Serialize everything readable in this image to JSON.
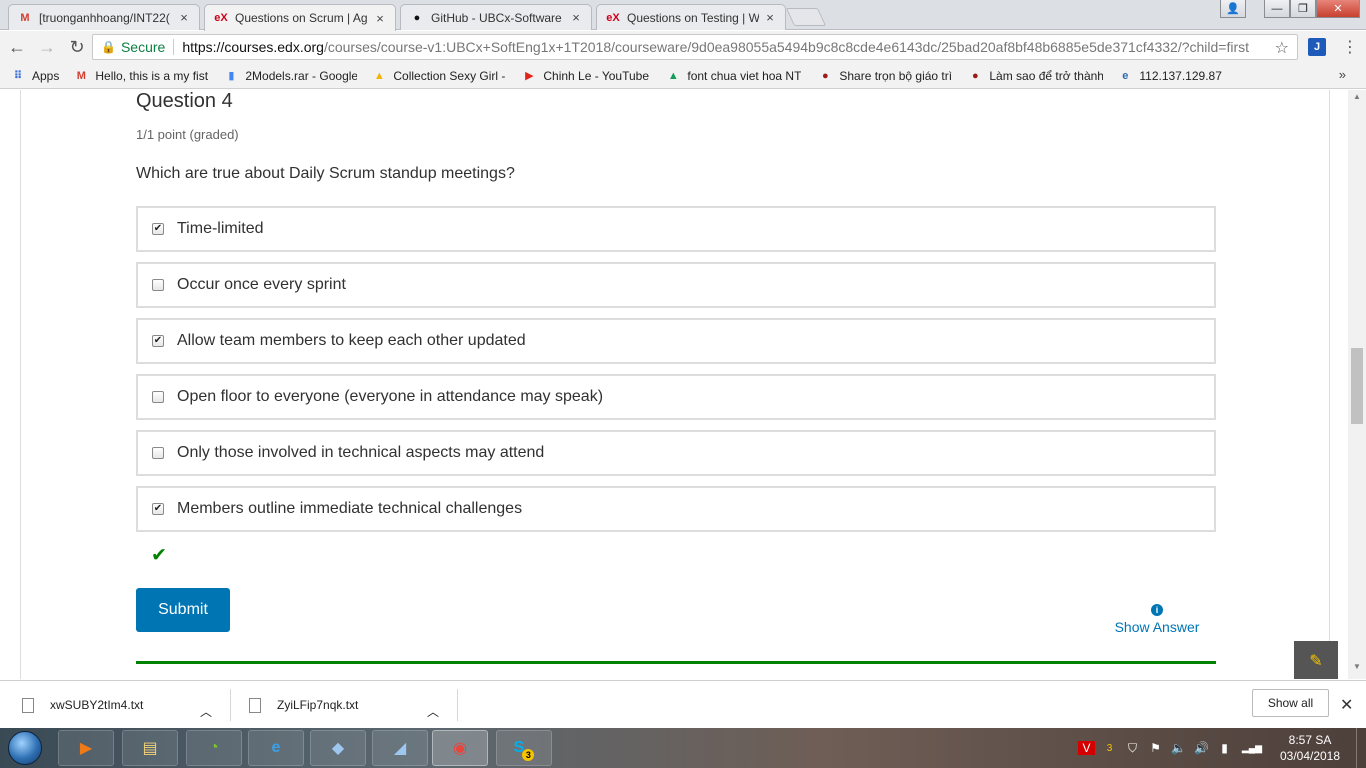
{
  "browser": {
    "tabs": [
      {
        "icon": "gmail-icon",
        "glyph": "M",
        "color": "#d23f31",
        "title": "[truonganhhoang/INT22(",
        "close": "×"
      },
      {
        "icon": "edx-icon",
        "glyph": "eX",
        "color": "#d0021b",
        "title": "Questions on Scrum | Ag",
        "close": "×"
      },
      {
        "icon": "github-icon",
        "glyph": "●",
        "color": "#111111",
        "title": "GitHub - UBCx-Software",
        "close": "×"
      },
      {
        "icon": "edx-icon",
        "glyph": "eX",
        "color": "#d0021b",
        "title": "Questions on Testing | W",
        "close": "×"
      }
    ],
    "window_buttons": {
      "minimize": "—",
      "maximize": "❐",
      "close": "✕",
      "user": "👤"
    },
    "nav": {
      "back": "←",
      "forward": "→",
      "reload": "↻"
    },
    "address": {
      "secure_label": "Secure",
      "url_host": "https://courses.edx.org",
      "url_rest": "/courses/course-v1:UBCx+SoftEng1x+1T2018/courseware/9d0ea98055a5494b9c8c8cde4e6143dc/25bad20af8bf48b6885e5de371cf4332/?child=first",
      "star": "☆"
    },
    "extension_glyph": "J",
    "menu_glyph": "⋮",
    "bookmarks": [
      {
        "icon": "apps-icon",
        "glyph": "⠿",
        "color": "#3b6fd6",
        "label": "Apps"
      },
      {
        "icon": "gmail-icon",
        "glyph": "M",
        "color": "#d23f31",
        "label": "Hello, this is a my fist"
      },
      {
        "icon": "doc-icon",
        "glyph": "▮",
        "color": "#4285f4",
        "label": "2Models.rar - Google"
      },
      {
        "icon": "drive-icon",
        "glyph": "▲",
        "color": "#f4b400",
        "label": "Collection Sexy Girl -"
      },
      {
        "icon": "youtube-icon",
        "glyph": "▶",
        "color": "#e62117",
        "label": "Chinh Le - YouTube"
      },
      {
        "icon": "drive-icon",
        "glyph": "▲",
        "color": "#0f9d58",
        "label": "font chua viet hoa NT"
      },
      {
        "icon": "site-icon",
        "glyph": "●",
        "color": "#9b1c1c",
        "label": "Share trọn bộ giáo trì"
      },
      {
        "icon": "site-icon",
        "glyph": "●",
        "color": "#9b1c1c",
        "label": "Làm sao để trở thành"
      },
      {
        "icon": "globe-icon",
        "glyph": "e",
        "color": "#2b6cb0",
        "label": "112.137.129.87"
      }
    ],
    "bookmarks_more": "»"
  },
  "problem": {
    "title": "Question 4",
    "points": "1/1 point (graded)",
    "prompt": "Which are true about Daily Scrum standup meetings?",
    "choices": [
      {
        "label": "Time-limited",
        "checked": true,
        "mark": "✔"
      },
      {
        "label": "Occur once every sprint",
        "checked": false,
        "mark": ""
      },
      {
        "label": "Allow team members to keep each other updated",
        "checked": true,
        "mark": "✔"
      },
      {
        "label": "Open floor to everyone (everyone in attendance may speak)",
        "checked": false,
        "mark": ""
      },
      {
        "label": "Only those involved in technical aspects may attend",
        "checked": false,
        "mark": ""
      },
      {
        "label": "Members outline immediate technical challenges",
        "checked": true,
        "mark": "✔"
      }
    ],
    "status_icon": "✔",
    "submit_label": "Submit",
    "show_answer_label": "Show Answer",
    "info_glyph": "i",
    "pencil_glyph": "✎",
    "accent_color": "#0075b4",
    "correct_color": "#008100"
  },
  "scrollbar": {
    "up": "▲",
    "down": "▼"
  },
  "downloads": {
    "items": [
      {
        "name": "xwSUBY2tIm4.txt",
        "chevron": "︿"
      },
      {
        "name": "ZyiLFip7nqk.txt",
        "chevron": "︿"
      }
    ],
    "show_all": "Show all",
    "close": "✕"
  },
  "taskbar": {
    "apps": [
      {
        "icon": "media-player-icon",
        "glyph": "▶",
        "color": "#f07a18"
      },
      {
        "icon": "file-explorer-icon",
        "glyph": "▤",
        "color": "#f3d27a"
      },
      {
        "icon": "app-green-icon",
        "glyph": "◔",
        "color": "#7ec42b"
      },
      {
        "icon": "internet-explorer-icon",
        "glyph": "e",
        "color": "#3aa0e6"
      },
      {
        "icon": "virtualbox-icon",
        "glyph": "◆",
        "color": "#9ec7ef"
      },
      {
        "icon": "mysql-workbench-icon",
        "glyph": "◢",
        "color": "#9ec7ef"
      },
      {
        "icon": "chrome-icon",
        "glyph": "◉",
        "color": "#e8453c"
      },
      {
        "icon": "skype-icon",
        "glyph": "S",
        "color": "#00aff0"
      }
    ],
    "skype_badge": "3",
    "tray_badge": "3",
    "tray": [
      {
        "icon": "vivaldi-icon",
        "glyph": "V"
      },
      {
        "icon": "unikey-icon",
        "glyph": "◑"
      },
      {
        "icon": "shield-icon",
        "glyph": "⛉"
      },
      {
        "icon": "flag-icon",
        "glyph": "⚑"
      },
      {
        "icon": "volume-icon",
        "glyph": "🔈"
      },
      {
        "icon": "sound-icon",
        "glyph": "🔊"
      },
      {
        "icon": "network-icon",
        "glyph": "▮"
      },
      {
        "icon": "signal-icon",
        "glyph": "▂▄▆"
      }
    ],
    "time": "8:57 SA",
    "date": "03/04/2018"
  }
}
